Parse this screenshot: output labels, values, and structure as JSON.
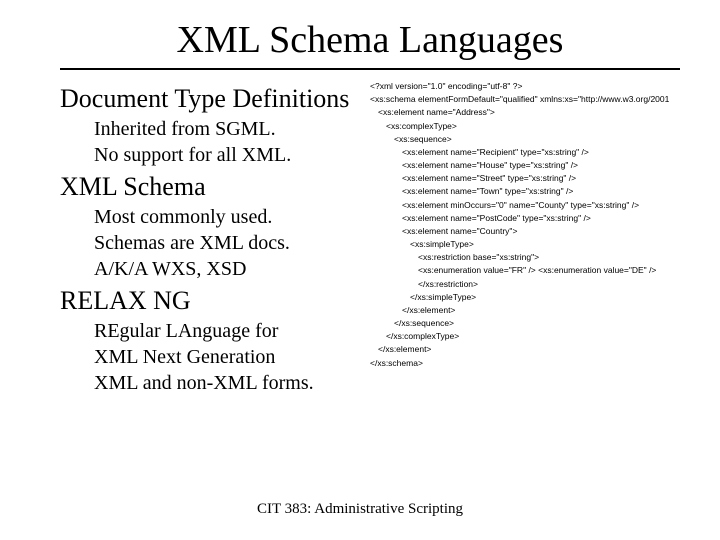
{
  "title": "XML Schema Languages",
  "left": {
    "dtd": {
      "heading": "Document Type Definitions",
      "line1": "Inherited from SGML.",
      "line2": "No support for all XML."
    },
    "xmlschema": {
      "heading": "XML Schema",
      "line1": "Most commonly used.",
      "line2": "Schemas are XML docs.",
      "line3": "A/K/A WXS, XSD"
    },
    "relaxng": {
      "heading": "RELAX NG",
      "line1": "REgular LAnguage for",
      "line2": "XML Next Generation",
      "line3": "XML and non-XML forms."
    }
  },
  "code": {
    "l1": "<?xml version=\"1.0\" encoding=\"utf-8\" ?>",
    "l2": "<xs:schema elementFormDefault=\"qualified\" xmlns:xs=\"http://www.w3.org/2001",
    "l3": "<xs:element name=\"Address\">",
    "l4": "<xs:complexType>",
    "l5": "<xs:sequence>",
    "l6": "<xs:element name=\"Recipient\" type=\"xs:string\" />",
    "l7": "<xs:element name=\"House\" type=\"xs:string\" />",
    "l8": "<xs:element name=\"Street\" type=\"xs:string\" />",
    "l9": "<xs:element name=\"Town\" type=\"xs:string\" />",
    "l10": "<xs:element minOccurs=\"0\" name=\"County\" type=\"xs:string\" />",
    "l11": "<xs:element name=\"PostCode\" type=\"xs:string\" />",
    "l12": "<xs:element name=\"Country\">",
    "l13": "<xs:simpleType>",
    "l14": "<xs:restriction base=\"xs:string\">",
    "l15": "<xs:enumeration value=\"FR\" /> <xs:enumeration value=\"DE\" />",
    "l16": "</xs:restriction>",
    "l17": "</xs:simpleType>",
    "l18": "</xs:element>",
    "l19": "</xs:sequence>",
    "l20": "</xs:complexType>",
    "l21": "</xs:element>",
    "l22": "</xs:schema>"
  },
  "footer": "CIT 383: Administrative Scripting"
}
